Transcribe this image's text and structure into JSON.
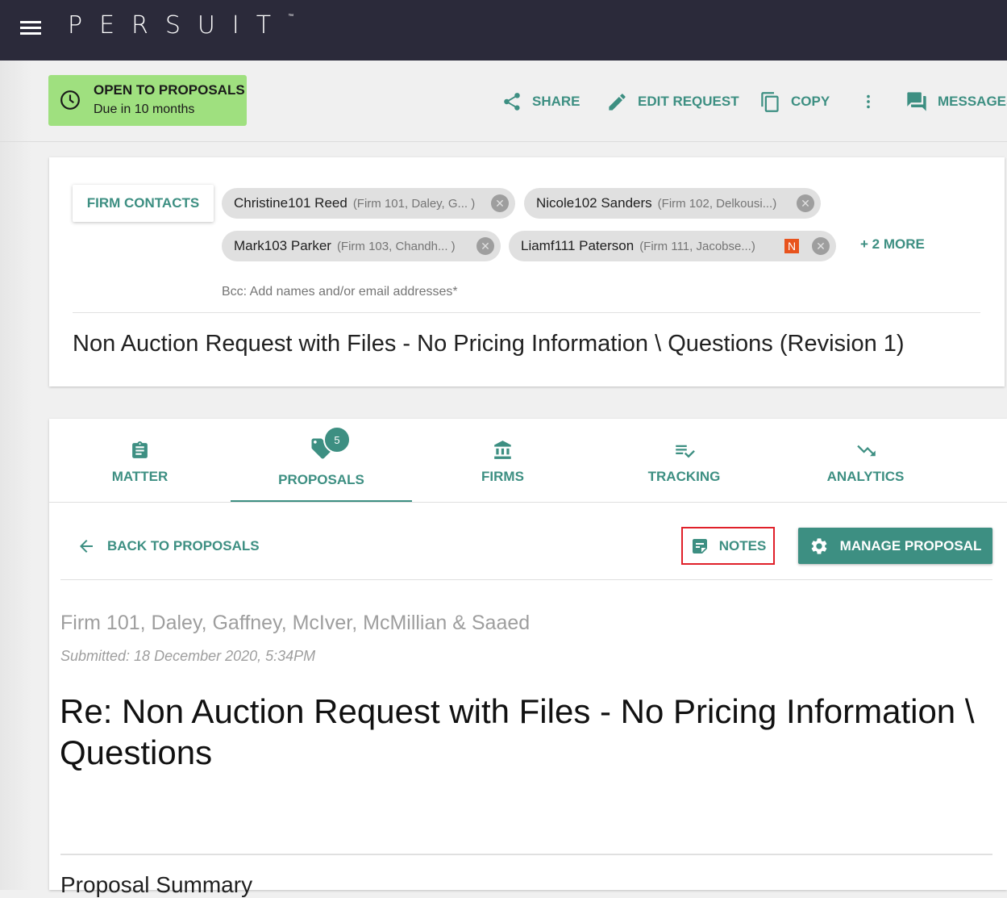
{
  "app": {
    "logo": "PERSUIT",
    "trademark": "™"
  },
  "status": {
    "title": "OPEN TO PROPOSALS",
    "due": "Due in 10 months",
    "color": "#9fe07f"
  },
  "actions": {
    "share": "SHARE",
    "edit": "EDIT REQUEST",
    "copy": "COPY",
    "messages": "MESSAGES"
  },
  "contacts": {
    "button": "FIRM CONTACTS",
    "chips": [
      {
        "name": "Christine101 Reed",
        "firm": "(Firm 101, Daley, G... )"
      },
      {
        "name": "Nicole102 Sanders",
        "firm": "(Firm 102, Delkousi...)"
      },
      {
        "name": "Mark103 Parker",
        "firm": "(Firm 103, Chandh... )"
      },
      {
        "name": "Liamf111 Paterson",
        "firm": "(Firm 111, Jacobse...)",
        "badge": "N"
      }
    ],
    "more": "+ 2 MORE",
    "bcc_placeholder": "Bcc: Add names and/or email addresses*"
  },
  "request_title": "Non Auction Request with Files - No Pricing Information \\ Questions (Revision 1)",
  "tabs": [
    {
      "label": "MATTER",
      "icon": "clipboard-icon"
    },
    {
      "label": "PROPOSALS",
      "icon": "tag-icon",
      "badge": "5",
      "active": true
    },
    {
      "label": "FIRMS",
      "icon": "bank-icon"
    },
    {
      "label": "TRACKING",
      "icon": "list-check-icon"
    },
    {
      "label": "ANALYTICS",
      "icon": "trending-down-icon"
    }
  ],
  "proposal": {
    "back": "BACK TO PROPOSALS",
    "notes": "NOTES",
    "manage": "MANAGE PROPOSAL",
    "firm": "Firm 101, Daley, Gaffney, McIver, McMillian & Saaed",
    "submitted": "Submitted: 18 December 2020, 5:34PM",
    "title": "Re: Non Auction Request with Files - No Pricing Information \\ Questions",
    "summary_heading": "Proposal Summary"
  },
  "colors": {
    "accent": "#3d8f82",
    "topbar": "#2b2a3a",
    "highlight": "#e0202a"
  }
}
